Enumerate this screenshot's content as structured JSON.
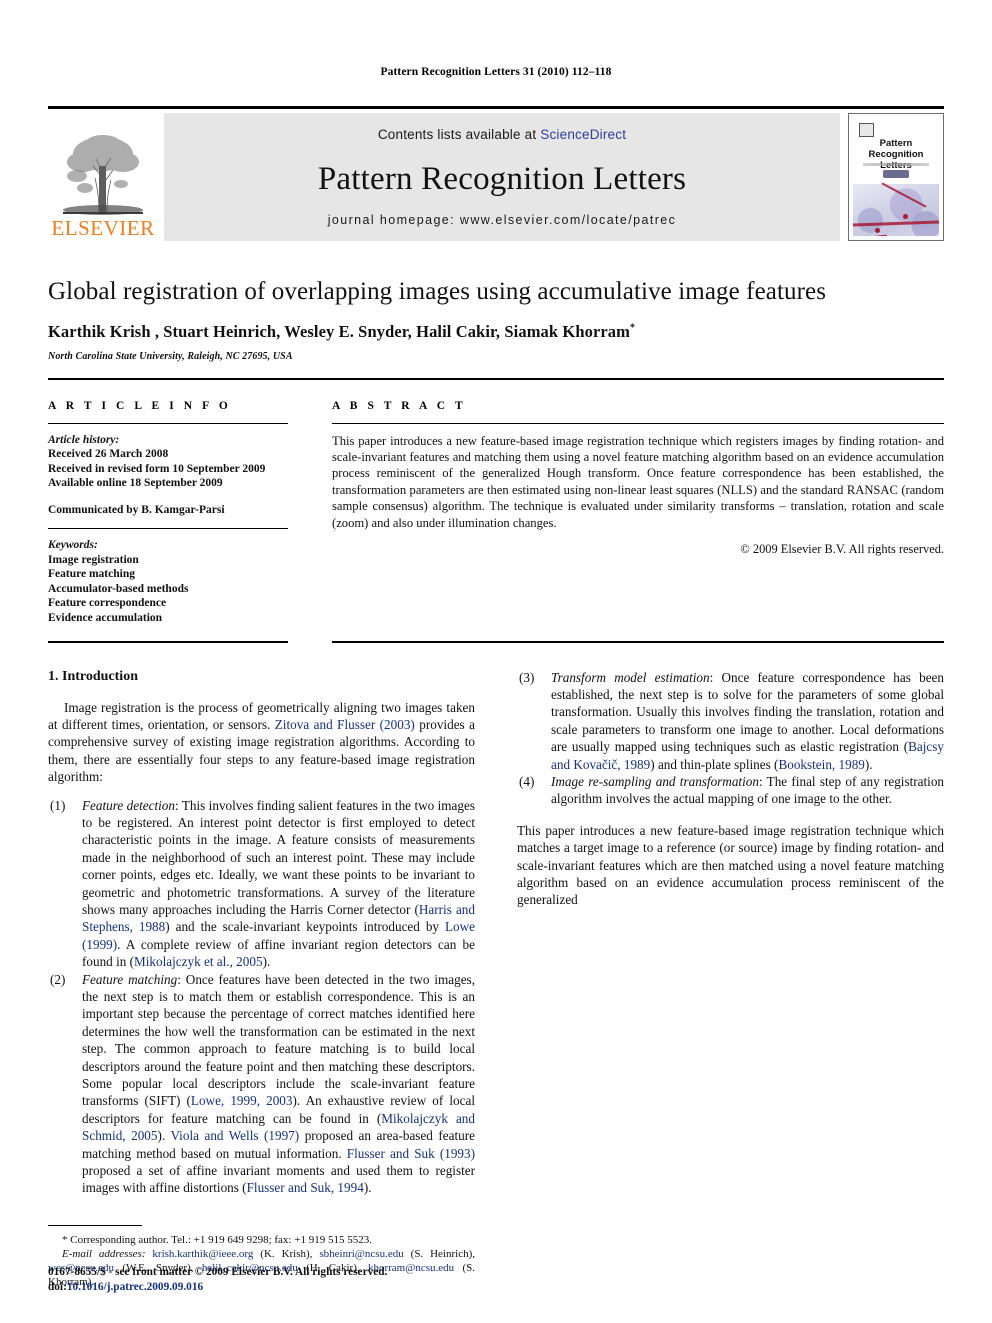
{
  "running_head": "Pattern Recognition Letters 31 (2010) 112–118",
  "masthead": {
    "contents_prefix": "Contents lists available at ",
    "sciencedirect": "ScienceDirect",
    "journal_name": "Pattern Recognition Letters",
    "homepage": "journal homepage: www.elsevier.com/locate/patrec",
    "publisher_wordmark": "ELSEVIER",
    "cover_title_line1": "Pattern Recognition",
    "cover_title_line2": "Letters",
    "accent_color": "#F07C1C",
    "link_color": "#2f3d9e",
    "band_color": "#e6e6e6"
  },
  "title_block": {
    "title": "Global registration of overlapping images using accumulative image features",
    "authors": "Karthik Krish , Stuart Heinrich, Wesley E. Snyder, Halil Cakir, Siamak Khorram",
    "author_marker": "*",
    "affiliation": "North Carolina State University, Raleigh, NC 27695, USA"
  },
  "article_info": {
    "heading": "A R T I C L E   I N F O",
    "history_label": "Article history:",
    "history": [
      "Received 26 March 2008",
      "Received in revised form 10 September 2009",
      "Available online 18 September 2009"
    ],
    "communicated_by": "Communicated by B. Kamgar-Parsi",
    "keywords_label": "Keywords:",
    "keywords": [
      "Image registration",
      "Feature matching",
      "Accumulator-based methods",
      "Feature correspondence",
      "Evidence accumulation"
    ]
  },
  "abstract": {
    "heading": "A B S T R A C T",
    "text": "This paper introduces a new feature-based image registration technique which registers images by finding rotation- and scale-invariant features and matching them using a novel feature matching algorithm based on an evidence accumulation process reminiscent of the generalized Hough transform. Once feature correspondence has been established, the transformation parameters are then estimated using non-linear least squares (NLLS) and the standard RANSAC (random sample consensus) algorithm. The technique is evaluated under similarity transforms – translation, rotation and scale (zoom) and also under illumination changes.",
    "copyright": "© 2009 Elsevier B.V. All rights reserved."
  },
  "body": {
    "section_title": "1. Introduction",
    "intro_par_a": "Image registration is the process of geometrically aligning two images taken at different times, orientation, or sensors. ",
    "intro_ref_1": "Zitova and Flusser (2003)",
    "intro_par_b": " provides a comprehensive survey of existing image registration algorithms. According to them, there are essentially four steps to any feature-based image registration algorithm:",
    "steps": [
      {
        "number": "(1)",
        "title": "Feature detection",
        "text_a": ": This involves finding salient features in the two images to be registered. An interest point detector is first employed to detect characteristic points in the image. A feature consists of measurements made in the neighborhood of such an interest point. These may include corner points, edges etc. Ideally, we want these points to be invariant to geometric and photometric transformations. A survey of the literature shows many approaches including the Harris Corner detector (",
        "ref_1": "Harris and Stephens, 1988",
        "text_b": ") and the scale-invariant keypoints introduced by ",
        "ref_2": "Lowe (1999)",
        "text_c": ". A complete review of affine invariant region detectors can be found in (",
        "ref_3": "Mikolajczyk et al., 2005",
        "text_d": ")."
      },
      {
        "number": "(2)",
        "title": "Feature matching",
        "text_a": ": Once features have been detected in the two images, the next step is to match them or establish correspondence. This is an important step because the percentage of correct matches identified here determines the how well the transformation can be estimated in the next step. The common approach to feature matching is to build local descriptors around the feature point and then matching these descriptors. Some popular local descriptors include the scale-invariant feature transforms (SIFT) (",
        "ref_1": "Lowe, 1999, 2003",
        "text_b": "). An exhaustive review of local descriptors for feature matching can be found in (",
        "ref_2": "Mikolajczyk and Schmid, 2005",
        "text_c": "). ",
        "ref_3": "Viola and Wells (1997)",
        "text_d": " proposed an area-based feature matching method based on mutual information. ",
        "ref_4": "Flusser and Suk (1993)",
        "text_e": " proposed a set of affine invariant moments and used them to register images with affine distortions (",
        "ref_5": "Flusser and Suk, 1994",
        "text_f": ")."
      },
      {
        "number": "(3)",
        "title": "Transform model estimation",
        "text_a": ": Once feature correspondence has been established, the next step is to solve for the parameters of some global transformation. Usually this involves finding the translation, rotation and scale parameters to transform one image to another. Local deformations are usually mapped using techniques such as elastic registration (",
        "ref_1": "Bajcsy and Kovačič, 1989",
        "text_b": ") and thin-plate splines (",
        "ref_2": "Bookstein, 1989",
        "text_c": ")."
      },
      {
        "number": "(4)",
        "title": "Image re-sampling and transformation",
        "text_a": ": The final step of any registration algorithm involves the actual mapping of one image to the other."
      }
    ],
    "closing_par": "This paper introduces a new feature-based image registration technique which matches a target image to a reference (or source) image by finding rotation- and scale-invariant features which are then matched using a novel feature matching algorithm based on an evidence accumulation process reminiscent of the generalized"
  },
  "footnote": {
    "corresponding": "Corresponding author. Tel.: +1 919 649 9298; fax: +1 919 515 5523.",
    "email_label": "E-mail addresses:",
    "emails": [
      {
        "address": "krish.karthik@ieee.org",
        "name": " (K. Krish), "
      },
      {
        "address": "sbheinri@ncsu.edu",
        "name": " (S. Heinrich), "
      },
      {
        "address": "wes@ncsu.edu",
        "name": " (W.E. Snyder), "
      },
      {
        "address": "halil_cakir@ncsu.edu",
        "name": " (H. Cakir), "
      },
      {
        "address": "khorram@ncsu.edu",
        "name": " (S. Khorram)."
      }
    ]
  },
  "imprint": {
    "issn_line": "0167-8655/$ - see front matter © 2009 Elsevier B.V. All rights reserved.",
    "doi_label": "doi:",
    "doi_value": "10.1016/j.patrec.2009.09.016"
  }
}
